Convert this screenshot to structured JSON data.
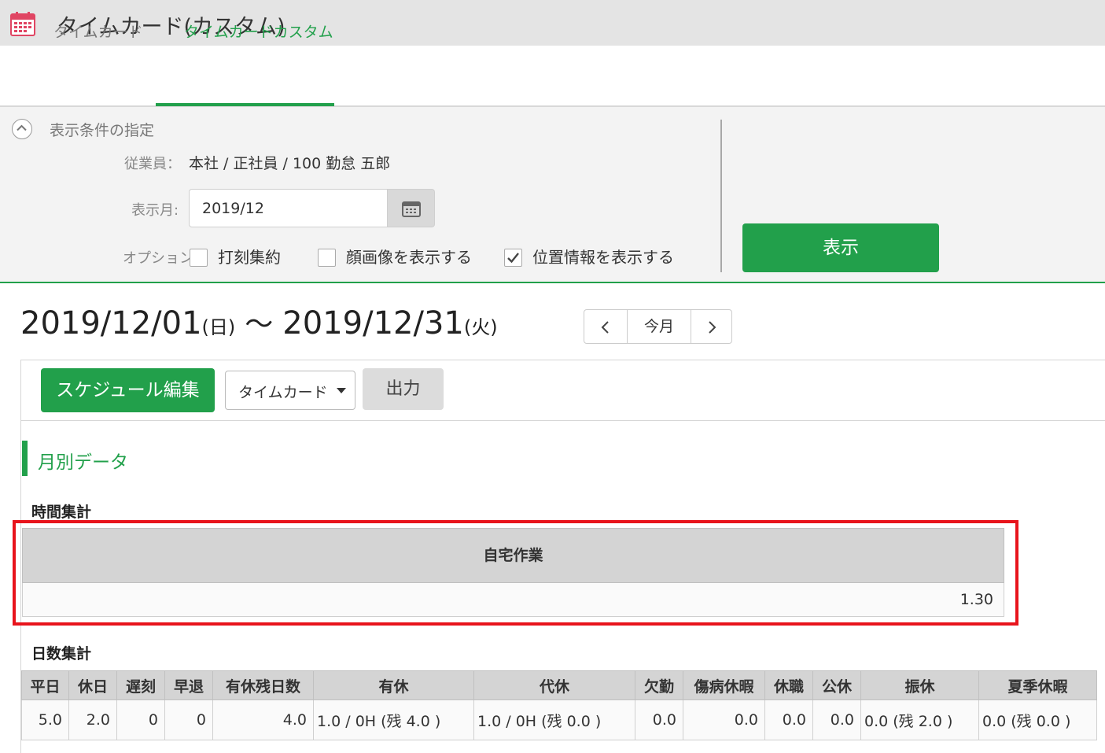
{
  "app": {
    "title": "タイムカード(カスタム)"
  },
  "tabs": [
    {
      "label": "タイムカード"
    },
    {
      "label": "タイムカードカスタム"
    }
  ],
  "conditions": {
    "title": "表示条件の指定",
    "employee_label": "従業員：",
    "employee_value": "本社 / 正社員 / 100 勤怠 五郎",
    "month_label": "表示月:",
    "month_value": "2019/12",
    "options_label": "オプション:",
    "options": [
      {
        "label": "打刻集約",
        "checked": false
      },
      {
        "label": "顔画像を表示する",
        "checked": false
      },
      {
        "label": "位置情報を表示する",
        "checked": true
      }
    ],
    "show_button": "表示"
  },
  "range": {
    "start": "2019/12/01",
    "start_day": "(日)",
    "separator": "〜",
    "end": "2019/12/31",
    "end_day": "(火)"
  },
  "nav": {
    "today": "今月"
  },
  "toolbar": {
    "schedule_button": "スケジュール編集",
    "view_select": "タイムカード",
    "output_button": "出力"
  },
  "section": {
    "title": "月別データ",
    "time_summary": "時間集計",
    "day_summary": "日数集計"
  },
  "time_table": {
    "header": "自宅作業",
    "value": "1.30"
  },
  "days_table": {
    "headers": [
      "平日",
      "休日",
      "遅刻",
      "早退",
      "有休残日数",
      "有休",
      "代休",
      "欠勤",
      "傷病休暇",
      "休職",
      "公休",
      "振休",
      "夏季休暇"
    ],
    "values": [
      "5.0",
      "2.0",
      "0",
      "0",
      "4.0",
      "1.0 / 0H (残 4.0 )",
      "1.0 / 0H (残 0.0 )",
      "0.0",
      "0.0",
      "0.0",
      "0.0",
      "0.0 (残 2.0 )",
      "0.0 (残 0.0 )"
    ]
  },
  "colors": {
    "accent": "#22a04b",
    "highlight": "#e8141c"
  },
  "icons": [
    "calendar-app-icon",
    "chevron-up-icon",
    "calendar-icon",
    "check-icon",
    "chevron-left-icon",
    "chevron-right-icon",
    "caret-down-icon"
  ]
}
